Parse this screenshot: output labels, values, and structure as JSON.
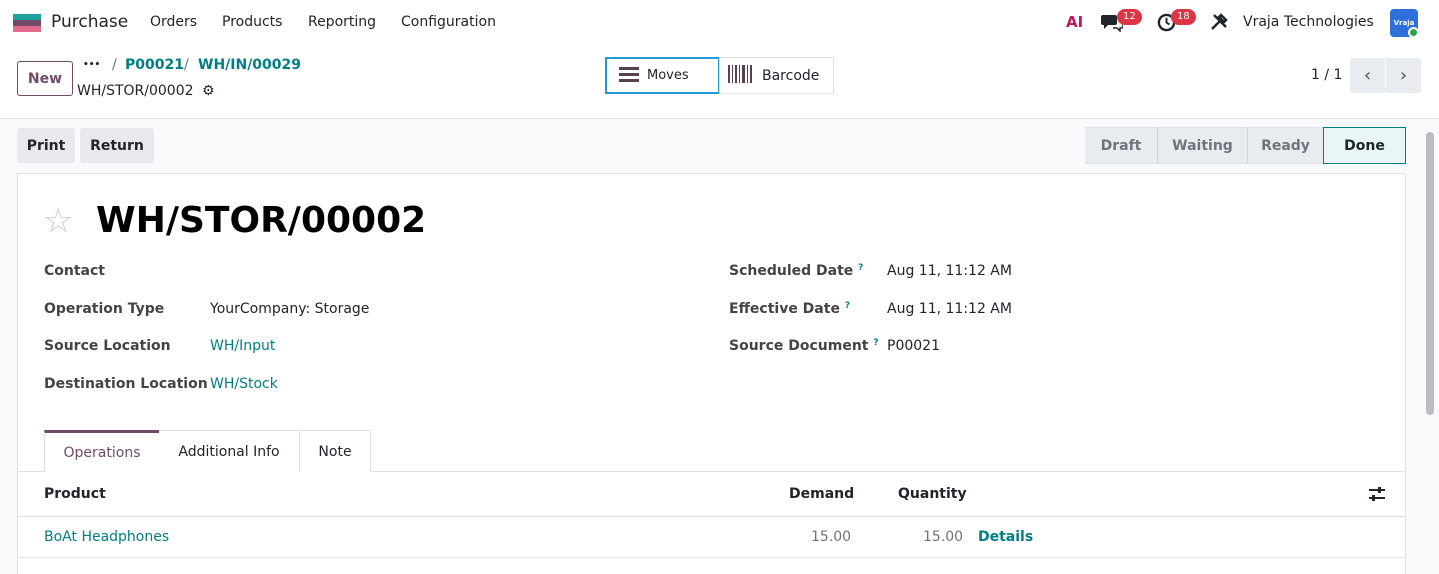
{
  "navbar": {
    "app_name": "Purchase",
    "menus": [
      "Orders",
      "Products",
      "Reporting",
      "Configuration"
    ],
    "ai_label": "AI",
    "messages_count": "12",
    "activities_count": "18",
    "company": "Vraja Technologies",
    "avatar_text": "Vraja",
    "brand_color": "#714b67"
  },
  "control": {
    "new_label": "New",
    "dots": "•••",
    "breadcrumbs": [
      "P00021",
      "WH/IN/00029"
    ],
    "record_name": "WH/STOR/00002",
    "smart_buttons": [
      "Moves",
      "Barcode"
    ],
    "pager": "1 / 1"
  },
  "actions": {
    "print": "Print",
    "return": "Return"
  },
  "statusbar": {
    "stages": [
      "Draft",
      "Waiting",
      "Ready",
      "Done"
    ],
    "current": "Done"
  },
  "form": {
    "title": "WH/STOR/00002",
    "left_fields": [
      {
        "label": "Contact",
        "value": ""
      },
      {
        "label": "Operation Type",
        "value": "YourCompany: Storage"
      },
      {
        "label": "Source Location",
        "value": "WH/Input"
      },
      {
        "label": "Destination Location",
        "value": "WH/Stock"
      }
    ],
    "right_fields": [
      {
        "label": "Scheduled Date",
        "value": "Aug 11, 11:12 AM"
      },
      {
        "label": "Effective Date",
        "value": "Aug 11, 11:12 AM"
      },
      {
        "label": "Source Document",
        "value": "P00021"
      }
    ],
    "help_mark": "?"
  },
  "tabs": [
    "Operations",
    "Additional Info",
    "Note"
  ],
  "table": {
    "headers": [
      "Product",
      "Demand",
      "Quantity"
    ],
    "rows": [
      {
        "product": "BoAt Headphones",
        "demand": "15.00",
        "quantity": "15.00",
        "details": "Details"
      }
    ]
  }
}
